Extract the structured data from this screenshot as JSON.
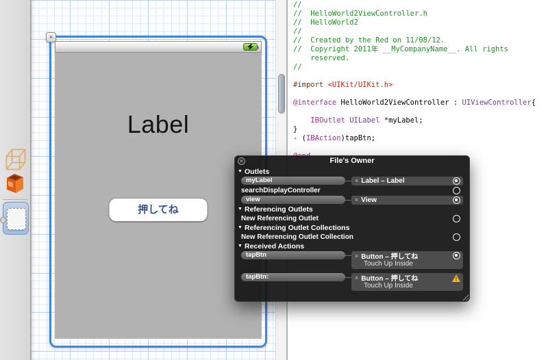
{
  "icons": {
    "close": "×",
    "disconnect": "×",
    "section_triangle": "▼",
    "warning": "!"
  },
  "colors": {
    "selection_blue": "#3e86e2",
    "hud_background": "#131313",
    "warning_yellow": "#f5b41f",
    "view_gray": "#b2b2b2",
    "button_text_blue": "#36548f",
    "battery_green": "#55a51d"
  },
  "dock": {
    "items": [
      {
        "id": "files-owner",
        "icon": "wireframe-cube-icon"
      },
      {
        "id": "first-responder",
        "icon": "orange-cube-icon"
      },
      {
        "id": "view",
        "icon": "view-square-icon",
        "selected": true
      }
    ]
  },
  "canvas": {
    "label_text": "Label",
    "button_text": "押してね"
  },
  "code": {
    "colors": {
      "comment": "#1e9224",
      "preproc": "#6a3a20",
      "string": "#c4261d",
      "keyword": "#aa2c96",
      "type": "#6a3fa6",
      "plain": "#000000"
    },
    "lines": [
      [
        {
          "t": "//",
          "c": "comment"
        }
      ],
      [
        {
          "t": "//  HelloWorld2ViewController.h",
          "c": "comment"
        }
      ],
      [
        {
          "t": "//  HelloWorld2",
          "c": "comment"
        }
      ],
      [
        {
          "t": "//",
          "c": "comment"
        }
      ],
      [
        {
          "t": "//  Created by the Red on 11/08/12.",
          "c": "comment"
        }
      ],
      [
        {
          "t": "//  Copyright 2011年 __MyCompanyName__. All rights",
          "c": "comment"
        }
      ],
      [
        {
          "t": "    reserved.",
          "c": "comment"
        }
      ],
      [
        {
          "t": "//",
          "c": "comment"
        }
      ],
      [],
      [
        {
          "t": "#import ",
          "c": "preproc"
        },
        {
          "t": "<UIKit/UIKit.h>",
          "c": "string"
        }
      ],
      [],
      [
        {
          "t": "@interface",
          "c": "keyword"
        },
        {
          "t": " HelloWorld2ViewController : ",
          "c": "plain"
        },
        {
          "t": "UIViewController",
          "c": "type"
        },
        {
          "t": "{",
          "c": "plain"
        }
      ],
      [],
      [
        {
          "t": "    ",
          "c": "plain"
        },
        {
          "t": "IBOutlet",
          "c": "keyword"
        },
        {
          "t": " ",
          "c": "plain"
        },
        {
          "t": "UILabel",
          "c": "type"
        },
        {
          "t": " *myLabel;",
          "c": "plain"
        }
      ],
      [
        {
          "t": "}",
          "c": "plain"
        }
      ],
      [
        {
          "t": "- (",
          "c": "plain"
        },
        {
          "t": "IBAction",
          "c": "keyword"
        },
        {
          "t": ")tapBtn;",
          "c": "plain"
        }
      ],
      [],
      [
        {
          "t": "@end",
          "c": "keyword"
        }
      ]
    ]
  },
  "panel": {
    "title": "File's Owner",
    "rows": [
      {
        "type": "section",
        "label": "Outlets"
      },
      {
        "type": "row",
        "source": "myLabel",
        "pill": true,
        "target": "Label – Label",
        "state": "connected"
      },
      {
        "type": "row",
        "source": "searchDisplayController",
        "pill": false,
        "state": "empty"
      },
      {
        "type": "row",
        "source": "view",
        "pill": true,
        "target": "View",
        "state": "connected"
      },
      {
        "type": "section",
        "label": "Referencing Outlets"
      },
      {
        "type": "row",
        "source": "New Referencing Outlet",
        "pill": false,
        "state": "empty"
      },
      {
        "type": "section",
        "label": "Referencing Outlet Collections"
      },
      {
        "type": "row",
        "source": "New Referencing Outlet Collection",
        "pill": false,
        "state": "empty"
      },
      {
        "type": "section",
        "label": "Received Actions"
      },
      {
        "type": "row",
        "source": "tapBtn",
        "pill": true,
        "target": "Button – 押してね",
        "detail": "Touch Up Inside",
        "state": "connected"
      },
      {
        "type": "row",
        "source": "tapBtn:",
        "pill": true,
        "target": "Button – 押してね",
        "detail": "Touch Up Inside",
        "state": "warning"
      }
    ]
  }
}
